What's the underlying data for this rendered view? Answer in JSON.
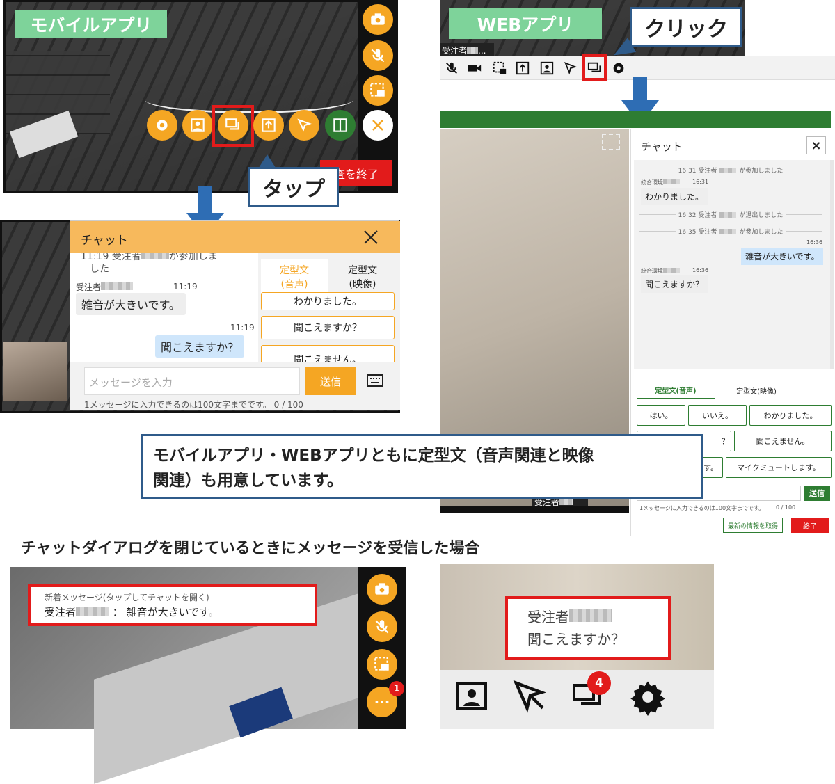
{
  "labels": {
    "mobile_app": "モバイルアプリ",
    "web_app": "WEBアプリ",
    "tap": "タップ",
    "click": "クリック",
    "callout_main_l1": "モバイルアプリ・WEBアプリともに定型文（音声関連と映像",
    "callout_main_l2": "関連）も用意しています。",
    "section_heading": "チャットダイアログを閉じているときにメッセージを受信した場合"
  },
  "mobile_top": {
    "end_button": "査を終了"
  },
  "mobile_chat": {
    "title": "チャット",
    "sys_partial": "11:19 受注者",
    "sys_partial2": "が参加しま",
    "sys_partial3": "した",
    "msg1_sender": "受注者",
    "msg1_time": "11:19",
    "msg1_text": "雑音が大きいです。",
    "msg2_time": "11:19",
    "msg2_text": "聞こえますか？",
    "tab1_l1": "定型文",
    "tab1_l2": "(音声)",
    "tab2_l1": "定型文",
    "tab2_l2": "(映像)",
    "tpl_items": [
      "わかりました。",
      "聞こえますか？",
      "聞こえません。"
    ],
    "input_placeholder": "メッセージを入力",
    "send": "送信",
    "hint": "1メッセージに入力できるのは100文字までです。 0 / 100"
  },
  "web_top": {
    "user": "受注者",
    "ellipsis": "..."
  },
  "web_chat": {
    "title": "チャット",
    "close": "×",
    "sys1": "16:31 受注者",
    "sys1b": "が参加しました",
    "msg1_sender": "統合環境",
    "msg1_time": "16:31",
    "msg1_text": "わかりました。",
    "sys2": "16:32 受注者",
    "sys2b": "が退出しました",
    "sys3": "16:35 受注者",
    "sys3b": "が参加しました",
    "msg2_time": "16:36",
    "msg2_text": "雑音が大きいです。",
    "msg3_sender": "統合環境",
    "msg3_time": "16:36",
    "msg3_text": "聞こえますか？",
    "tab1": "定型文(音声)",
    "tab2": "定型文(映像)",
    "tpl_row1": [
      "はい。",
      "いいえ。",
      "わかりました。"
    ],
    "tpl_row2_right": "聞こえません。",
    "tpl_row2_left": "？",
    "tpl_row3_right": "マイクミュートします。",
    "tpl_row3_left": "す。",
    "send": "送信",
    "hint": "1メッセージに入力できるのは100文字までです。",
    "count": "0 / 100",
    "refresh": "最新の情報を取得",
    "end": "終了",
    "video_user": "受注者"
  },
  "mobile_notify": {
    "title": "新着メッセージ(タップしてチャットを開く)",
    "sender": "受注者",
    "colon": "：",
    "text": "雑音が大きいです。",
    "badge": "1",
    "more": "···"
  },
  "web_notify": {
    "sender": "受注者",
    "text": "聞こえますか？",
    "badge": "4"
  },
  "colors": {
    "orange": "#f5a623",
    "green": "#2e7d32",
    "red": "#e21b1b",
    "navy": "#2f5b8a",
    "arrow": "#2e6db4"
  }
}
